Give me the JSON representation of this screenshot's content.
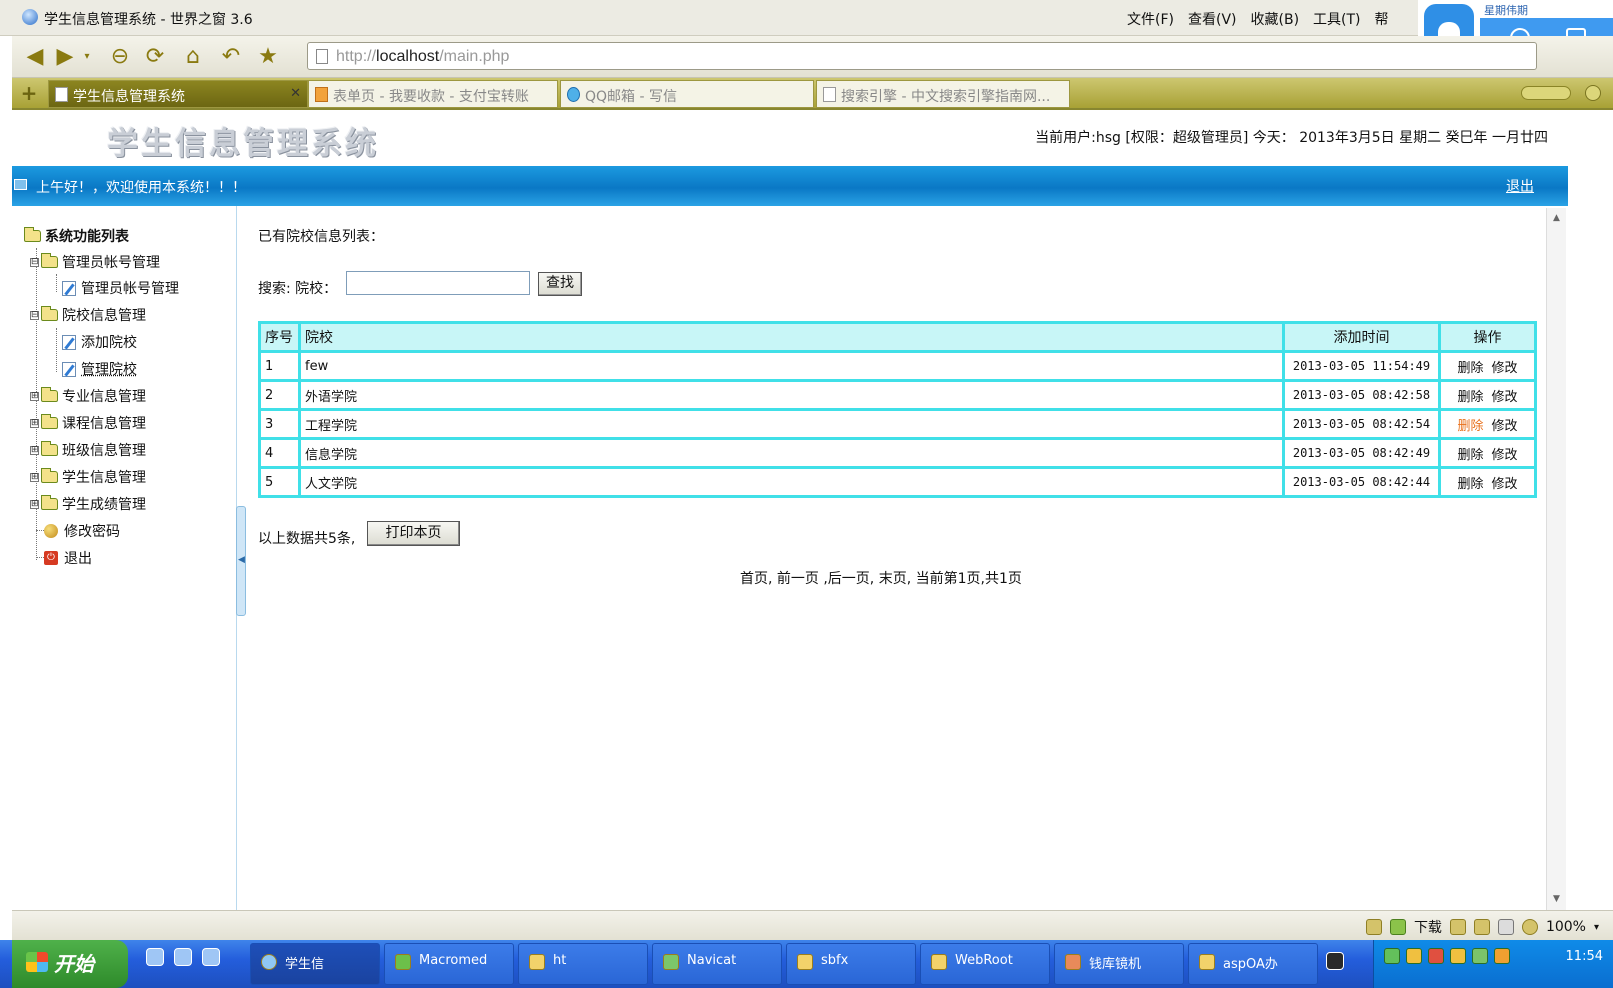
{
  "window": {
    "title": "学生信息管理系统 - 世界之窗 3.6",
    "menu": [
      "文件(F)",
      "查看(V)",
      "收藏(B)",
      "工具(T)",
      "帮"
    ]
  },
  "browser": {
    "url_prefix": "http://",
    "url_host": "localhost",
    "url_path": "/main.php",
    "tabs": [
      {
        "label": "学生信息管理系统",
        "active": true
      },
      {
        "label": "表单页 - 我要收款 - 支付宝转账",
        "active": false
      },
      {
        "label": "QQ邮箱 - 写信",
        "active": false
      },
      {
        "label": "搜索引擎 - 中文搜索引擎指南网...",
        "active": false
      }
    ]
  },
  "widget": {
    "promo": "星期伟期"
  },
  "header": {
    "logo": "学生信息管理系统",
    "userinfo": "当前用户:hsg [权限：超级管理员] 今天： 2013年3月5日 星期二 癸巳年 一月廿四"
  },
  "welcome": {
    "message": "上午好！，欢迎使用本系统！！！",
    "logout": "退出"
  },
  "sidebar": {
    "root": "系统功能列表",
    "items": [
      {
        "label": "管理员帐号管理",
        "type": "folder",
        "toggle": "⊟"
      },
      {
        "label": "管理员帐号管理",
        "type": "page"
      },
      {
        "label": "院校信息管理",
        "type": "folder",
        "toggle": "⊟"
      },
      {
        "label": "添加院校",
        "type": "page"
      },
      {
        "label": "管理院校",
        "type": "page"
      },
      {
        "label": "专业信息管理",
        "type": "folder",
        "toggle": "⊞"
      },
      {
        "label": "课程信息管理",
        "type": "folder",
        "toggle": "⊞"
      },
      {
        "label": "班级信息管理",
        "type": "folder",
        "toggle": "⊞"
      },
      {
        "label": "学生信息管理",
        "type": "folder",
        "toggle": "⊞"
      },
      {
        "label": "学生成绩管理",
        "type": "folder",
        "toggle": "⊞"
      },
      {
        "label": "修改密码",
        "type": "key"
      },
      {
        "label": "退出",
        "type": "exit"
      }
    ]
  },
  "main": {
    "heading": "已有院校信息列表：",
    "search_label": "搜索: 院校：",
    "search_value": "",
    "search_button": "查找",
    "columns": [
      "序号",
      "院校",
      "添加时间",
      "操作"
    ],
    "rows": [
      {
        "seq": "1",
        "school": "few",
        "time": "2013-03-05 11:54:49"
      },
      {
        "seq": "2",
        "school": "外语学院",
        "time": "2013-03-05 08:42:58"
      },
      {
        "seq": "3",
        "school": "工程学院",
        "time": "2013-03-05 08:42:54"
      },
      {
        "seq": "4",
        "school": "信息学院",
        "time": "2013-03-05 08:42:49"
      },
      {
        "seq": "5",
        "school": "人文学院",
        "time": "2013-03-05 08:42:44"
      }
    ],
    "op_delete": "删除",
    "op_edit": "修改",
    "total": "以上数据共5条,",
    "print_button": "打印本页",
    "pager": "首页, 前一页 ,后一页, 末页, 当前第1页,共1页"
  },
  "statusbar": {
    "download": "下载",
    "zoom": "100%"
  },
  "taskbar": {
    "start": "开始",
    "tasks": [
      "学生信",
      "Macromed",
      "ht",
      "Navicat",
      "sbfx",
      "WebRoot",
      "钱库镜机",
      "aspOA办"
    ],
    "clock": "11:54"
  },
  "colors": {
    "accent": "#0a78c5",
    "grid_border": "#40e0e8",
    "grid_header": "#c8f6f7",
    "hover_link": "#e8701b"
  }
}
